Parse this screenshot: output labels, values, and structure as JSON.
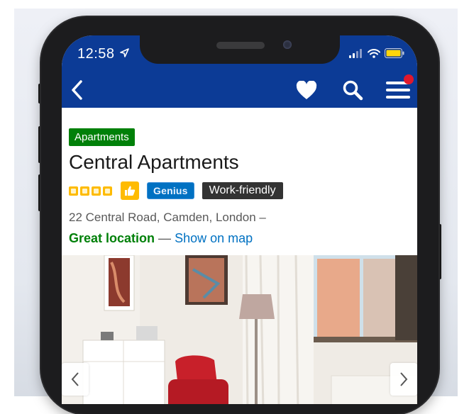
{
  "status_bar": {
    "time": "12:58"
  },
  "header": {
    "back_icon": "chevron-left-icon",
    "favorite_icon": "heart-icon",
    "search_icon": "search-icon",
    "menu_icon": "hamburger-menu-icon",
    "background_color": "#0c3b96",
    "notification_dot_color": "#e0182d"
  },
  "property": {
    "type_badge": "Apartments",
    "name": "Central Apartments",
    "star_count": 4,
    "genius_label": "Genius",
    "work_friendly_label": "Work-friendly",
    "address": "22 Central Road, Camden, London –",
    "location_label": "Great location",
    "separator": "—",
    "show_on_map": "Show on map"
  },
  "gallery": {
    "prev_icon": "chevron-left-icon",
    "next_icon": "chevron-right-icon"
  },
  "colors": {
    "green": "#008009",
    "link_blue": "#0071c2",
    "star_yellow": "#febb02"
  }
}
